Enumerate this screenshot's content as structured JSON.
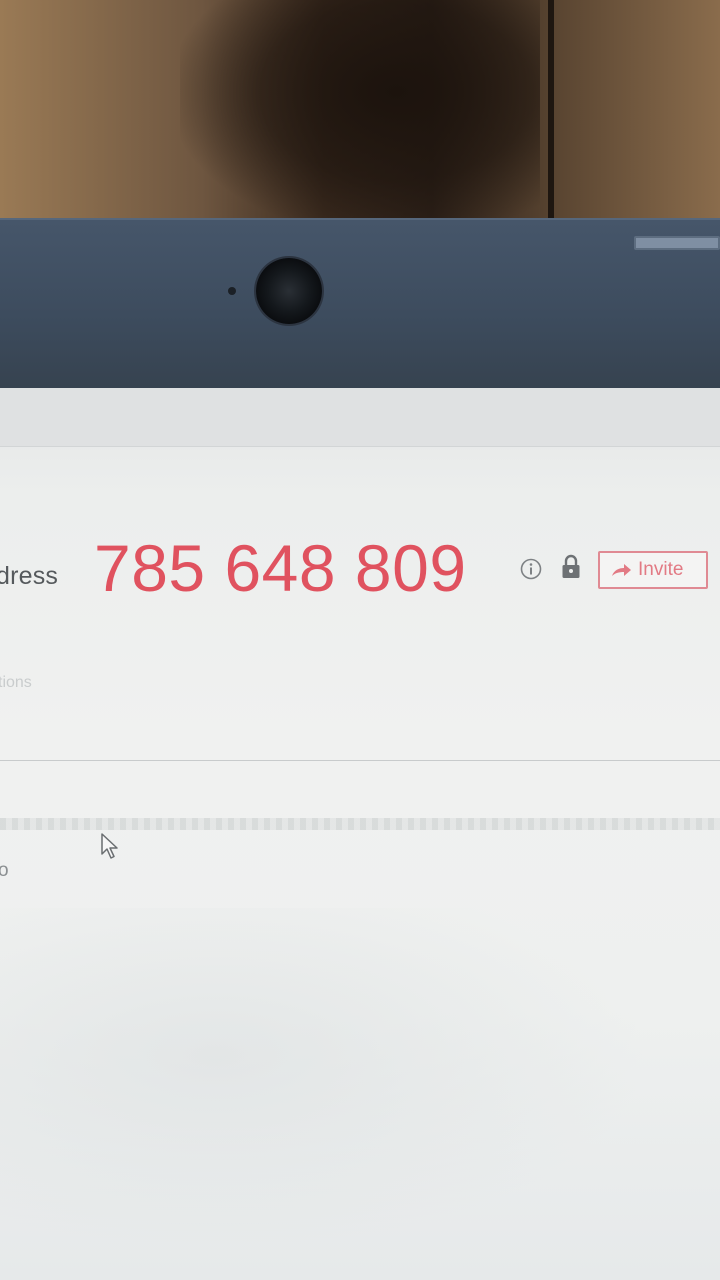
{
  "id_panel": {
    "address_label": "dress",
    "remote_id": "785 648 809",
    "invite_label": "Invite",
    "accent_color": "#e0525f"
  },
  "panel": {
    "faint_label": "tions",
    "small_text": "o"
  },
  "icons": {
    "info": "info-icon",
    "lock": "lock-icon",
    "invite": "share-arrow-icon",
    "cursor": "mouse-pointer-icon"
  }
}
